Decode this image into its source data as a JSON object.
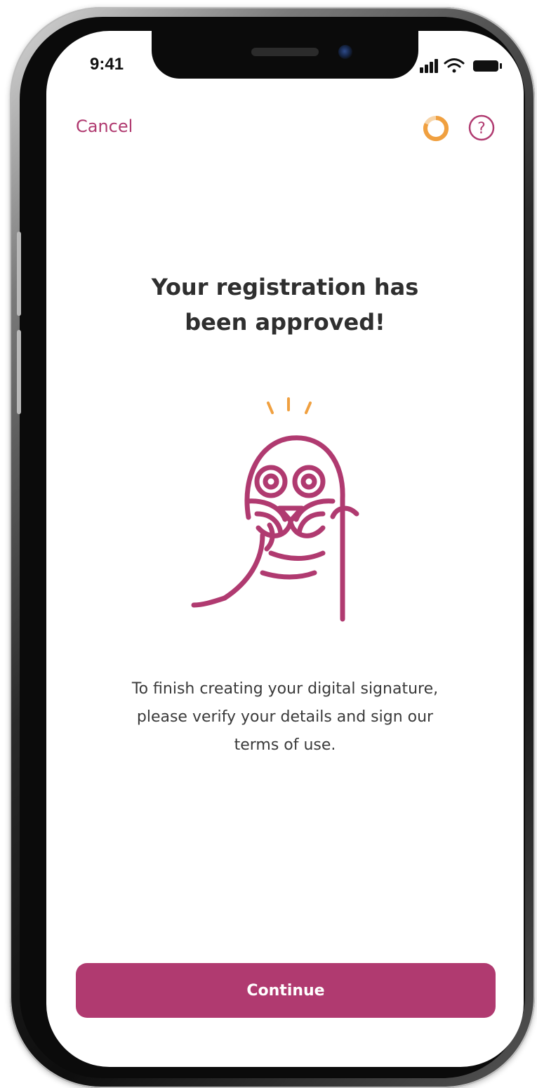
{
  "status_bar": {
    "time": "9:41",
    "icons": [
      "cellular-signal-icon",
      "wifi-icon",
      "battery-icon"
    ]
  },
  "header": {
    "cancel_label": "Cancel",
    "progress_icon": "progress-ring-icon",
    "help_icon": "help-icon",
    "help_glyph": "?"
  },
  "main": {
    "title_line1": "Your registration has",
    "title_line2": "been approved!",
    "illustration": "seal-mascot-illustration",
    "body_line1": "To finish creating your digital signature,",
    "body_line2": "please verify your details and sign our",
    "body_line3": "terms of use."
  },
  "footer": {
    "continue_label": "Continue"
  },
  "colors": {
    "accent": "#b03a70",
    "progress": "#f0a040",
    "text_dark": "#2f2f2f",
    "text_body": "#3a3a3a"
  }
}
